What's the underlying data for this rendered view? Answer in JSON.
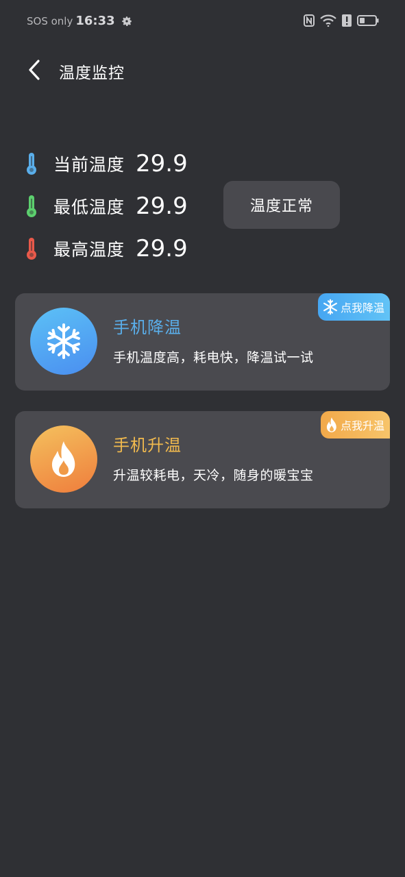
{
  "status_bar": {
    "carrier": "SOS only",
    "time": "16:33",
    "icons": [
      "gear-icon",
      "nfc-icon",
      "wifi-icon",
      "alert-icon",
      "battery-icon"
    ]
  },
  "header": {
    "title": "温度监控",
    "back_icon": "back-arrow-icon"
  },
  "temperatures": [
    {
      "label": "当前温度",
      "value": "29.9",
      "icon": "thermometer-icon",
      "color": "#5aaeea"
    },
    {
      "label": "最低温度",
      "value": "29.9",
      "icon": "thermometer-icon",
      "color": "#5ccf6e"
    },
    {
      "label": "最高温度",
      "value": "29.9",
      "icon": "thermometer-icon",
      "color": "#e8594a"
    }
  ],
  "status_pill": {
    "text": "温度正常"
  },
  "cards": [
    {
      "title": "手机降温",
      "description": "手机温度高，耗电快，降温试一试",
      "badge": "点我降温",
      "icon": "snowflake-icon",
      "accent": "#5aaeea"
    },
    {
      "title": "手机升温",
      "description": "升温较耗电，天冷，随身的暖宝宝",
      "badge": "点我升温",
      "icon": "flame-icon",
      "accent": "#f0b94e"
    }
  ],
  "colors": {
    "background": "#2f3034",
    "card": "#4a4a4f"
  }
}
